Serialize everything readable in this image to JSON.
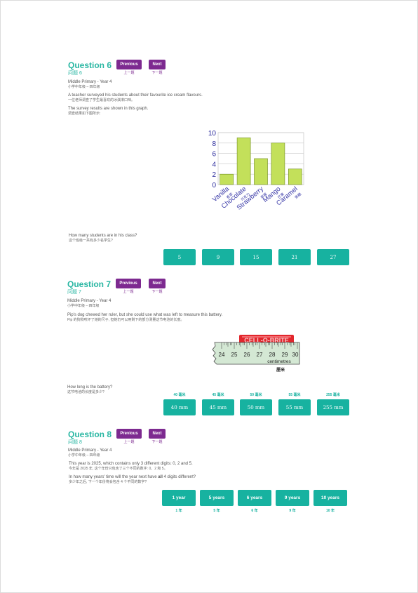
{
  "nav": {
    "previous": "Previous",
    "previous_cn": "上一题",
    "next": "Next",
    "next_cn": "下一题"
  },
  "q6": {
    "title": "Question 6",
    "title_cn": "问题 6",
    "level": "Middle Primary - Year 4",
    "level_cn": "小学中年级 – 四年级",
    "line1": "A teacher surveyed his students about their favourite ice cream flavours.",
    "line1_cn": "一位老师调查了学生最喜欢的冰淇淋口味。",
    "line2": "The survey results are shown in this graph.",
    "line2_cn": "调查结果如下图所示:",
    "question": "How many students are in his class?",
    "question_cn": "这个班级一共有多少名学生?",
    "answers": [
      "5",
      "9",
      "15",
      "21",
      "27"
    ]
  },
  "chart_data": {
    "type": "bar",
    "categories": [
      "Vanilla",
      "Chocolate",
      "Strawberry",
      "Mango",
      "Caramel"
    ],
    "categories_cn": [
      "香草",
      "巧克力",
      "草莓",
      "芒果",
      "焦糖"
    ],
    "values": [
      2,
      9,
      5,
      8,
      3
    ],
    "ylim": [
      0,
      10
    ],
    "yticks": [
      0,
      2,
      4,
      6,
      8,
      10
    ],
    "grid": true,
    "bar_color": "#c3e05a",
    "bar_border": "#6e8a1e"
  },
  "q7": {
    "title": "Question 7",
    "title_cn": "问题 7",
    "level": "Middle Primary - Year 4",
    "level_cn": "小学中年级 – 四年级",
    "line1": "Pip's dog chewed her ruler, but she could use what was left to measure this battery.",
    "line1_cn": "Pip 的狗狗咬坏了她的尺子, 但她仍可以用剩下的部分测量这节电池的长度。",
    "battery_label": "CELL-O-BRITE",
    "ruler_ticks": [
      "24",
      "25",
      "26",
      "27",
      "28",
      "29",
      "30"
    ],
    "ruler_unit": "centimetres",
    "ruler_unit_cn": "厘米",
    "question": "How long is the battery?",
    "question_cn": "这节电池的长度是多少?",
    "answers": [
      "40 mm",
      "45 mm",
      "50 mm",
      "55 mm",
      "255 mm"
    ],
    "answers_cn": [
      "40 毫米",
      "45 毫米",
      "50 毫米",
      "55 毫米",
      "255 毫米"
    ]
  },
  "q8": {
    "title": "Question 8",
    "title_cn": "问题 8",
    "level": "Middle Primary - Year 4",
    "level_cn": "小学中年级 – 四年级",
    "line1": "This year is 2025, which contains only 3 different digits: 0, 2 and 5.",
    "line1_cn": "今年是 2025 年, 这个年份只包含了三个不同的数字: 0、2 和 5。",
    "line2_pre": "In how many years' time will the year next have ",
    "line2_bold": "all",
    "line2_post": " 4 digits different?",
    "line2_cn": "多少年之后, 下一个年份将会包含 4 个不同的数字?",
    "answers": [
      "1 year",
      "5 years",
      "6 years",
      "9 years",
      "10 years"
    ],
    "answers_cn": [
      "1 年",
      "5 年",
      "6 年",
      "9 年",
      "10 年"
    ]
  }
}
